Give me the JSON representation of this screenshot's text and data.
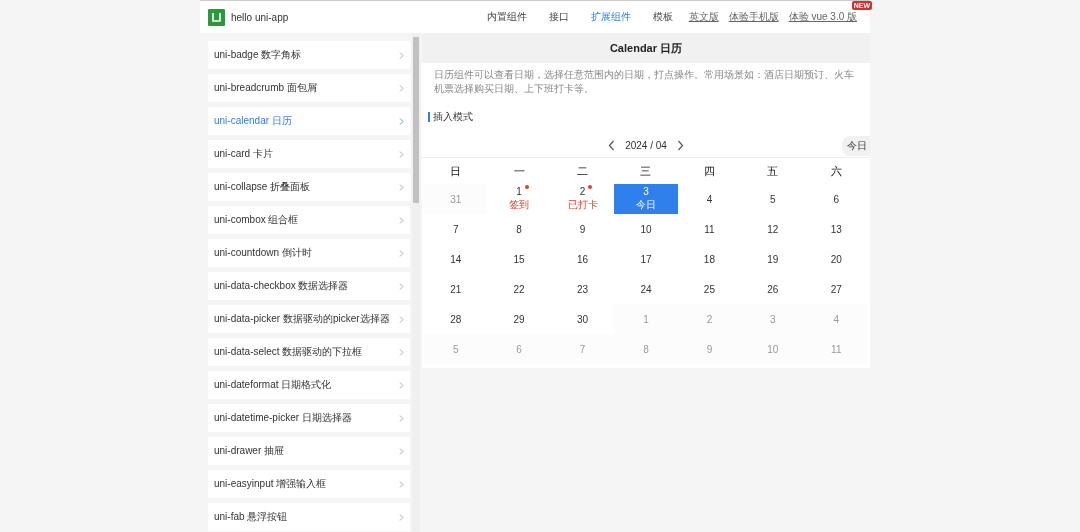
{
  "topbar": {
    "title": "hello uni-app",
    "nav": [
      {
        "label": "内置组件",
        "kind": "tab",
        "selected": false
      },
      {
        "label": "接口",
        "kind": "tab",
        "selected": false
      },
      {
        "label": "扩展组件",
        "kind": "tab",
        "selected": true
      },
      {
        "label": "模板",
        "kind": "tab",
        "selected": false
      },
      {
        "label": "英文版",
        "kind": "link"
      },
      {
        "label": "体验手机版",
        "kind": "link"
      },
      {
        "label": "体验 vue 3.0 版",
        "kind": "link",
        "badge": "NEW"
      }
    ]
  },
  "sidebar": {
    "items": [
      {
        "label": "uni-badge 数字角标",
        "selected": false
      },
      {
        "label": "uni-breadcrumb 面包屑",
        "selected": false
      },
      {
        "label": "uni-calendar 日历",
        "selected": true
      },
      {
        "label": "uni-card 卡片",
        "selected": false
      },
      {
        "label": "uni-collapse 折叠面板",
        "selected": false
      },
      {
        "label": "uni-combox 组合框",
        "selected": false
      },
      {
        "label": "uni-countdown 倒计时",
        "selected": false
      },
      {
        "label": "uni-data-checkbox 数据选择器",
        "selected": false
      },
      {
        "label": "uni-data-picker 数据驱动的picker选择器",
        "selected": false
      },
      {
        "label": "uni-data-select 数据驱动的下拉框",
        "selected": false
      },
      {
        "label": "uni-dateformat 日期格式化",
        "selected": false
      },
      {
        "label": "uni-datetime-picker 日期选择器",
        "selected": false
      },
      {
        "label": "uni-drawer 抽屉",
        "selected": false
      },
      {
        "label": "uni-easyinput 增强输入框",
        "selected": false
      },
      {
        "label": "uni-fab 悬浮按钮",
        "selected": false
      }
    ]
  },
  "page": {
    "title": "Calendar 日历",
    "description": "日历组件可以查看日期，选择任意范围内的日期，打点操作。常用场景如：酒店日期预订、火车机票选择购买日期、上下班打卡等。",
    "section": "插入模式",
    "calendar": {
      "month": "2024 / 04",
      "today_button": "今日",
      "weekdays": [
        "日",
        "一",
        "二",
        "三",
        "四",
        "五",
        "六"
      ],
      "days": [
        {
          "day": "31",
          "outside": true,
          "selected": false
        },
        {
          "day": "1",
          "outside": false,
          "selected": false,
          "dot": true,
          "note": "签到"
        },
        {
          "day": "2",
          "outside": false,
          "selected": false,
          "dot": true,
          "note": "已打卡"
        },
        {
          "day": "3",
          "outside": false,
          "selected": true,
          "note": "今日"
        },
        {
          "day": "4",
          "outside": false,
          "selected": false
        },
        {
          "day": "5",
          "outside": false,
          "selected": false
        },
        {
          "day": "6",
          "outside": false,
          "selected": false
        },
        {
          "day": "7",
          "outside": false,
          "selected": false
        },
        {
          "day": "8",
          "outside": false,
          "selected": false
        },
        {
          "day": "9",
          "outside": false,
          "selected": false
        },
        {
          "day": "10",
          "outside": false,
          "selected": false
        },
        {
          "day": "11",
          "outside": false,
          "selected": false
        },
        {
          "day": "12",
          "outside": false,
          "selected": false
        },
        {
          "day": "13",
          "outside": false,
          "selected": false
        },
        {
          "day": "14",
          "outside": false,
          "selected": false
        },
        {
          "day": "15",
          "outside": false,
          "selected": false
        },
        {
          "day": "16",
          "outside": false,
          "selected": false
        },
        {
          "day": "17",
          "outside": false,
          "selected": false
        },
        {
          "day": "18",
          "outside": false,
          "selected": false
        },
        {
          "day": "19",
          "outside": false,
          "selected": false
        },
        {
          "day": "20",
          "outside": false,
          "selected": false
        },
        {
          "day": "21",
          "outside": false,
          "selected": false
        },
        {
          "day": "22",
          "outside": false,
          "selected": false
        },
        {
          "day": "23",
          "outside": false,
          "selected": false
        },
        {
          "day": "24",
          "outside": false,
          "selected": false
        },
        {
          "day": "25",
          "outside": false,
          "selected": false
        },
        {
          "day": "26",
          "outside": false,
          "selected": false
        },
        {
          "day": "27",
          "outside": false,
          "selected": false
        },
        {
          "day": "28",
          "outside": false,
          "selected": false
        },
        {
          "day": "29",
          "outside": false,
          "selected": false
        },
        {
          "day": "30",
          "outside": false,
          "selected": false
        },
        {
          "day": "1",
          "outside": true,
          "selected": false
        },
        {
          "day": "2",
          "outside": true,
          "selected": false
        },
        {
          "day": "3",
          "outside": true,
          "selected": false
        },
        {
          "day": "4",
          "outside": true,
          "selected": false
        },
        {
          "day": "5",
          "outside": true,
          "selected": false
        },
        {
          "day": "6",
          "outside": true,
          "selected": false
        },
        {
          "day": "7",
          "outside": true,
          "selected": false
        },
        {
          "day": "8",
          "outside": true,
          "selected": false
        },
        {
          "day": "9",
          "outside": true,
          "selected": false
        },
        {
          "day": "10",
          "outside": true,
          "selected": false
        },
        {
          "day": "11",
          "outside": true,
          "selected": false
        }
      ]
    }
  }
}
